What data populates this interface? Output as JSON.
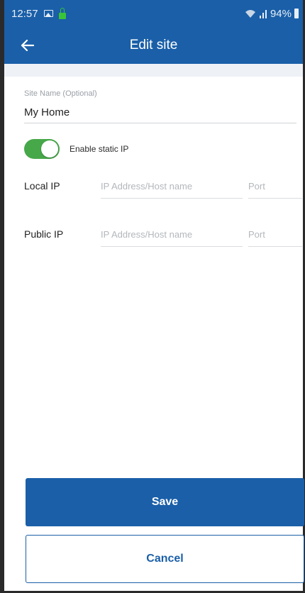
{
  "status_bar": {
    "time": "12:57",
    "battery": "94%",
    "icons": [
      "image-icon",
      "lock-icon",
      "wifi-icon",
      "signal-icon",
      "battery-icon"
    ]
  },
  "toolbar": {
    "title": "Edit site",
    "back_icon": "back-arrow-icon"
  },
  "form": {
    "site_name_label": "Site Name (Optional)",
    "site_name_value": "My Home",
    "static_ip_label": "Enable static IP",
    "static_ip_enabled": true,
    "local_ip": {
      "label": "Local IP",
      "address_placeholder": "IP Address/Host name",
      "port_placeholder": "Port"
    },
    "public_ip": {
      "label": "Public IP",
      "address_placeholder": "IP Address/Host name",
      "port_placeholder": "Port"
    }
  },
  "actions": {
    "save_label": "Save",
    "cancel_label": "Cancel"
  },
  "colors": {
    "primary": "#1a5fa8",
    "toggle_on": "#47a84a"
  }
}
